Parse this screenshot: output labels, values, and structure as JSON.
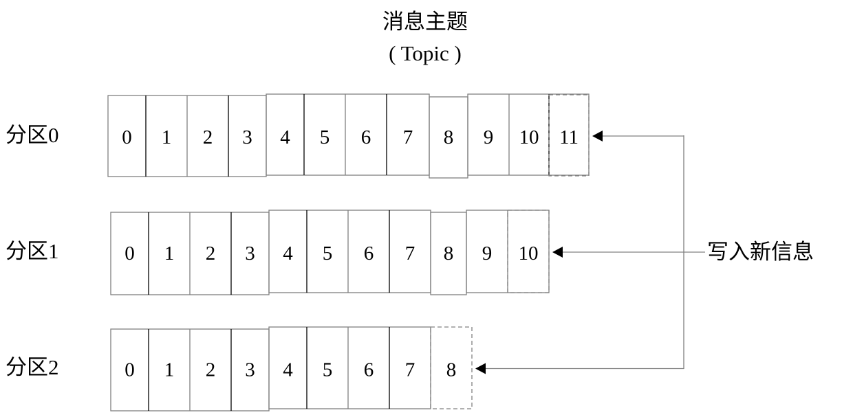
{
  "title": {
    "line1": "消息主题",
    "line2": "( Topic )"
  },
  "write_label": "写入新信息",
  "partitions": [
    {
      "label": "分区0",
      "cells": [
        "0",
        "1",
        "2",
        "3",
        "4",
        "5",
        "6",
        "7",
        "8",
        "9",
        "10"
      ],
      "new_cell": "11"
    },
    {
      "label": "分区1",
      "cells": [
        "0",
        "1",
        "2",
        "3",
        "4",
        "5",
        "6",
        "7",
        "8",
        "9"
      ],
      "new_cell": "10"
    },
    {
      "label": "分区2",
      "cells": [
        "0",
        "1",
        "2",
        "3",
        "4",
        "5",
        "6",
        "7"
      ],
      "new_cell": "8"
    }
  ],
  "colors": {
    "line": "#808080",
    "dark_line": "#000000",
    "arrow": "#000000"
  }
}
